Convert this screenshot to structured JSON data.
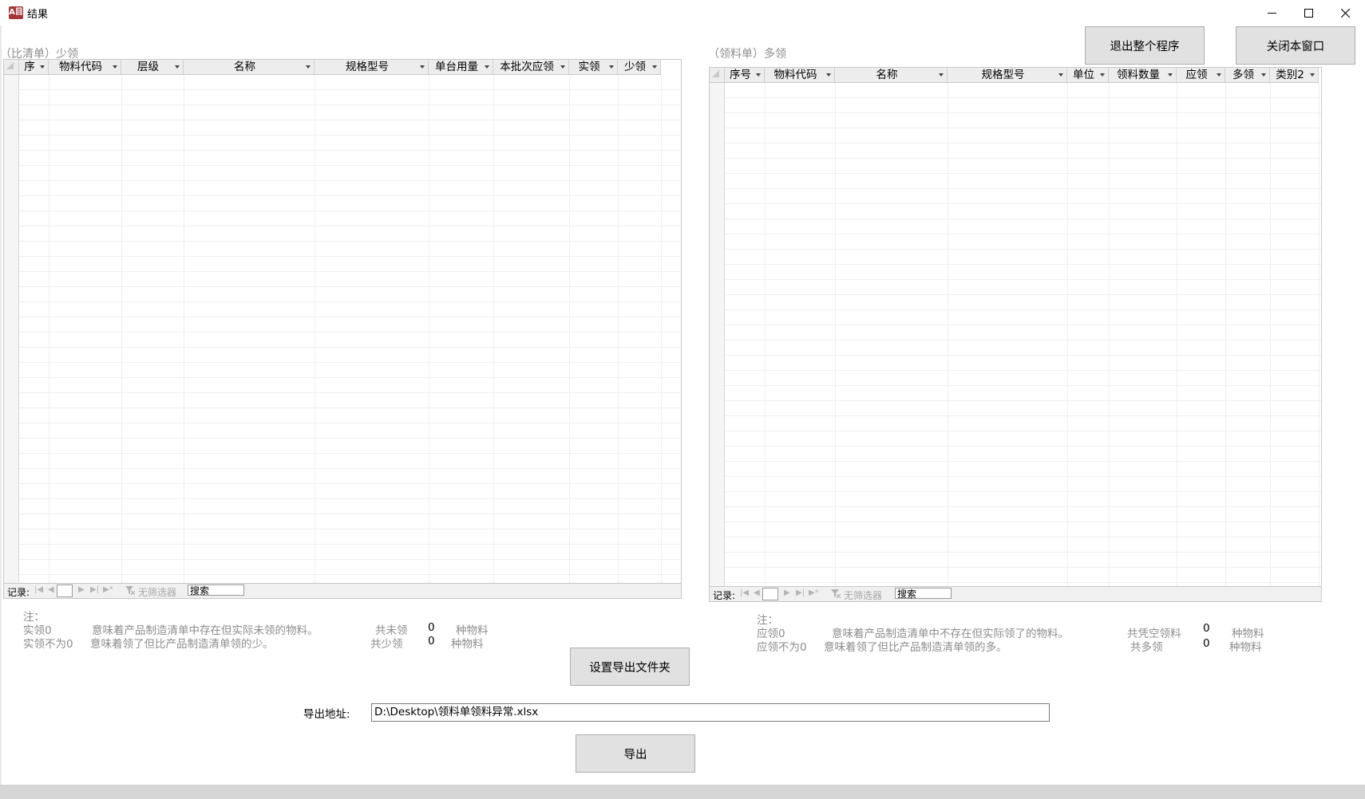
{
  "window": {
    "title": "结果",
    "icon_text": "A目",
    "minimize_icon": "minimize-icon",
    "maximize_icon": "maximize-icon",
    "close_icon": "close-icon"
  },
  "top_buttons": {
    "exit_program": "退出整个程序",
    "close_window": "关闭本窗口"
  },
  "left_panel": {
    "caption": "（比清单）少领",
    "columns": [
      "序",
      "物料代码",
      "层级",
      "名称",
      "规格型号",
      "单台用量",
      "本批次应领",
      "实领",
      "少领"
    ],
    "rows": [],
    "nav": {
      "record_label": "记录:",
      "filter_label": "无筛选器",
      "search_placeholder": "搜索"
    }
  },
  "right_panel": {
    "caption": "（领料单）多领",
    "columns": [
      "序号",
      "物料代码",
      "名称",
      "规格型号",
      "单位",
      "领料数量",
      "应领",
      "多领",
      "类别2"
    ],
    "rows": [],
    "nav": {
      "record_label": "记录:",
      "filter_label": "无筛选器",
      "search_placeholder": "搜索"
    }
  },
  "left_notes": {
    "heading": "注：",
    "line1_key": "实领0",
    "line1_text": "意味着产品制造清单中存在但实际未领的物料。",
    "line2_key": "实领不为0",
    "line2_text": "意味着领了但比产品制造清单领的少。",
    "count1_label": "共未领",
    "count1_value": "0",
    "count1_unit": "种物料",
    "count2_label": "共少领",
    "count2_value": "0",
    "count2_unit": "种物料"
  },
  "right_notes": {
    "heading": "注：",
    "line1_key": "应领0",
    "line1_text": "意味着产品制造清单中不存在但实际领了的物料。",
    "line2_key": "应领不为0",
    "line2_text": "意味着领了但比产品制造清单领的多。",
    "count1_label": "共凭空领料",
    "count1_value": "0",
    "count1_unit": "种物料",
    "count2_label": "共多领",
    "count2_value": "0",
    "count2_unit": "种物料"
  },
  "export": {
    "set_folder_button": "设置导出文件夹",
    "path_label": "导出地址:",
    "path_value": "D:\\Desktop\\领料单领料异常.xlsx",
    "export_button": "导出"
  }
}
